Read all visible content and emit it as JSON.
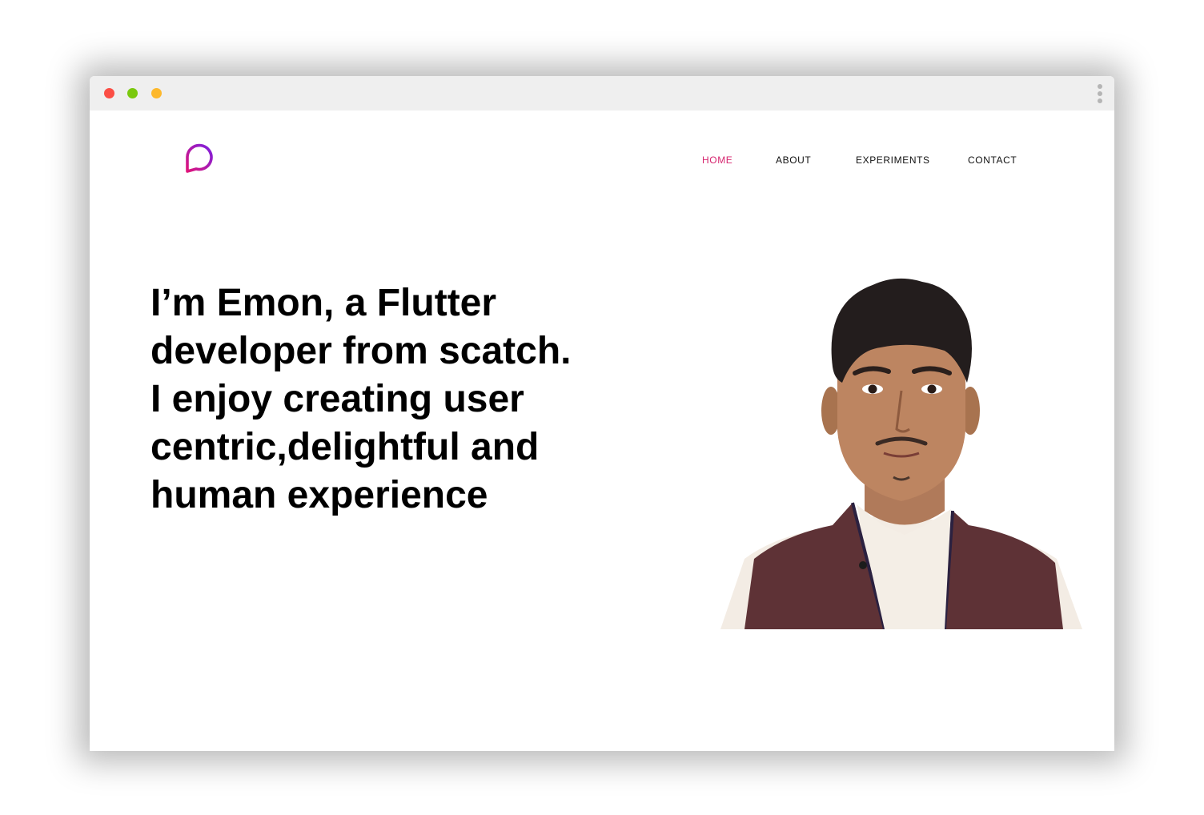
{
  "window": {
    "controls": [
      "close",
      "minimize",
      "maximize"
    ],
    "menu_icon": "kebab-menu-icon"
  },
  "logo": {
    "icon": "speech-bubble-logo-icon",
    "gradient": [
      "#e0157a",
      "#7b1fe0"
    ]
  },
  "nav": {
    "items": [
      {
        "label": "HOME",
        "active": true
      },
      {
        "label": "ABOUT",
        "active": false
      },
      {
        "label": "EXPERIMENTS",
        "active": false
      },
      {
        "label": "CONTACT",
        "active": false
      }
    ],
    "active_color": "#d6246e",
    "text_color": "#111111"
  },
  "hero": {
    "headline_lines": [
      "I’m Emon, a Flutter",
      "developer from scatch.",
      "I enjoy creating user",
      "centric,delightful and",
      "human experience"
    ],
    "portrait": "profile-photo"
  },
  "colors": {
    "close": "#fb4e45",
    "minimize": "#7ac90e",
    "maximize": "#fdb82c",
    "titlebar": "#efefef"
  }
}
